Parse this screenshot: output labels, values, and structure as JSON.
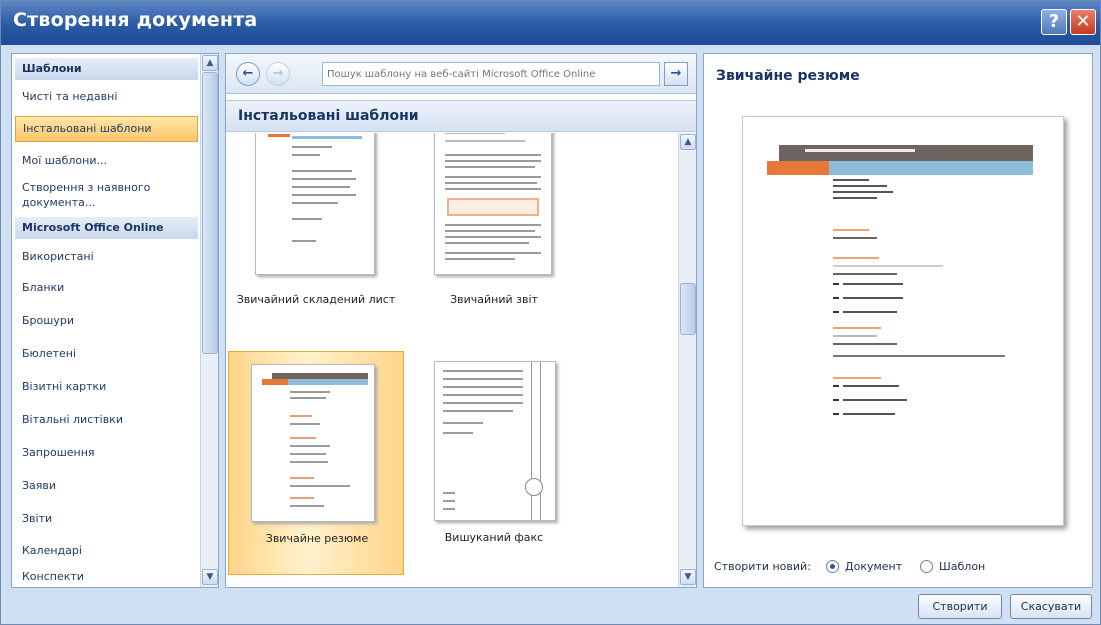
{
  "window": {
    "title": "Створення документа",
    "help_label": "?",
    "close_label": "✕"
  },
  "sidebar": {
    "items": [
      {
        "label": "Шаблони",
        "kind": "header"
      },
      {
        "label": "Чисті та недавні",
        "kind": "item"
      },
      {
        "label": "Інстальовані шаблони",
        "kind": "selected"
      },
      {
        "label": "Мої шаблони...",
        "kind": "item"
      },
      {
        "label": "Створення з наявного документа...",
        "kind": "item"
      },
      {
        "label": "Microsoft Office Online",
        "kind": "header"
      },
      {
        "label": "Використані",
        "kind": "item"
      },
      {
        "label": "Бланки",
        "kind": "item"
      },
      {
        "label": "Брошури",
        "kind": "item"
      },
      {
        "label": "Бюлетені",
        "kind": "item"
      },
      {
        "label": "Візитні картки",
        "kind": "item"
      },
      {
        "label": "Вітальні листівки",
        "kind": "item"
      },
      {
        "label": "Запрошення",
        "kind": "item"
      },
      {
        "label": "Заяви",
        "kind": "item"
      },
      {
        "label": "Звіти",
        "kind": "item"
      },
      {
        "label": "Календарі",
        "kind": "item"
      },
      {
        "label": "Конспекти",
        "kind": "item"
      }
    ]
  },
  "search": {
    "placeholder": "Пошук шаблону на веб-сайті Microsoft Office Online"
  },
  "gallery": {
    "heading": "Інстальовані шаблони",
    "templates": [
      {
        "label": "Звичайний складений лист"
      },
      {
        "label": "Звичайний звіт"
      },
      {
        "label": "Звичайне резюме"
      },
      {
        "label": "Вишуканий факс"
      }
    ],
    "selected": "Звичайне резюме"
  },
  "preview": {
    "title": "Звичайне резюме",
    "create_new_label": "Створити новий:",
    "options": [
      {
        "label": "Документ",
        "checked": true
      },
      {
        "label": "Шаблон",
        "checked": false
      }
    ]
  },
  "buttons": {
    "create": "Створити",
    "cancel": "Скасувати"
  },
  "colors": {
    "accent_orange": "#e8773a",
    "resume_bar_gray": "#6e6560",
    "resume_bar_blue": "#8dbdd8",
    "selection": "#ffc66b"
  }
}
